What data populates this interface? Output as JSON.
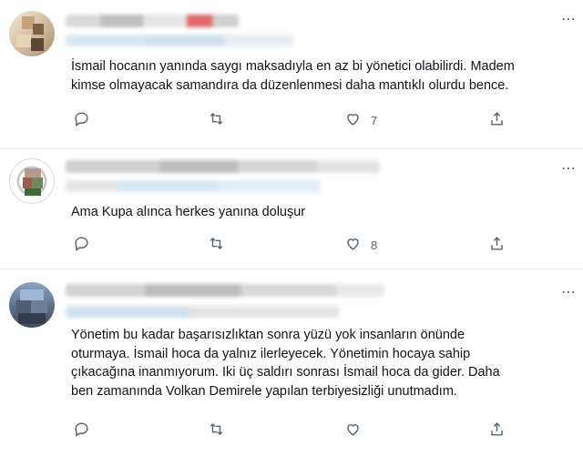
{
  "tweets": [
    {
      "text": "İsmail hocanın yanında saygı maksadıyla en az bi yönetici olabilirdi. Madem\nkimse olmayacak samandıra da düzenlenmesi daha mantıklı olurdu bence.",
      "reply_count": "",
      "retweet_count": "",
      "like_count": "7"
    },
    {
      "text": "Ama Kupa alınca herkes yanına doluşur",
      "reply_count": "",
      "retweet_count": "",
      "like_count": "8"
    },
    {
      "text": "Yönetim bu kadar başarısızlıktan sonra yüzü yok insanların önünde\noturmaya. İsmail hoca da yalnız ilerleyecek. Yönetimin hocaya sahip\nçıkacağına inanmıyorum. Iki üç saldırı sonrası İsmail hoca da gider. Daha\nben zamanında Volkan Demirele yapılan terbiyesizliği unutmadım.",
      "reply_count": "",
      "retweet_count": "",
      "like_count": ""
    }
  ],
  "icons": {
    "reply": "reply-icon",
    "retweet": "retweet-icon",
    "like": "heart-icon",
    "share": "share-icon",
    "more": "more-icon"
  },
  "colors": {
    "text": "#0f1419",
    "secondary": "#536471",
    "divider": "#e4e9ec"
  }
}
